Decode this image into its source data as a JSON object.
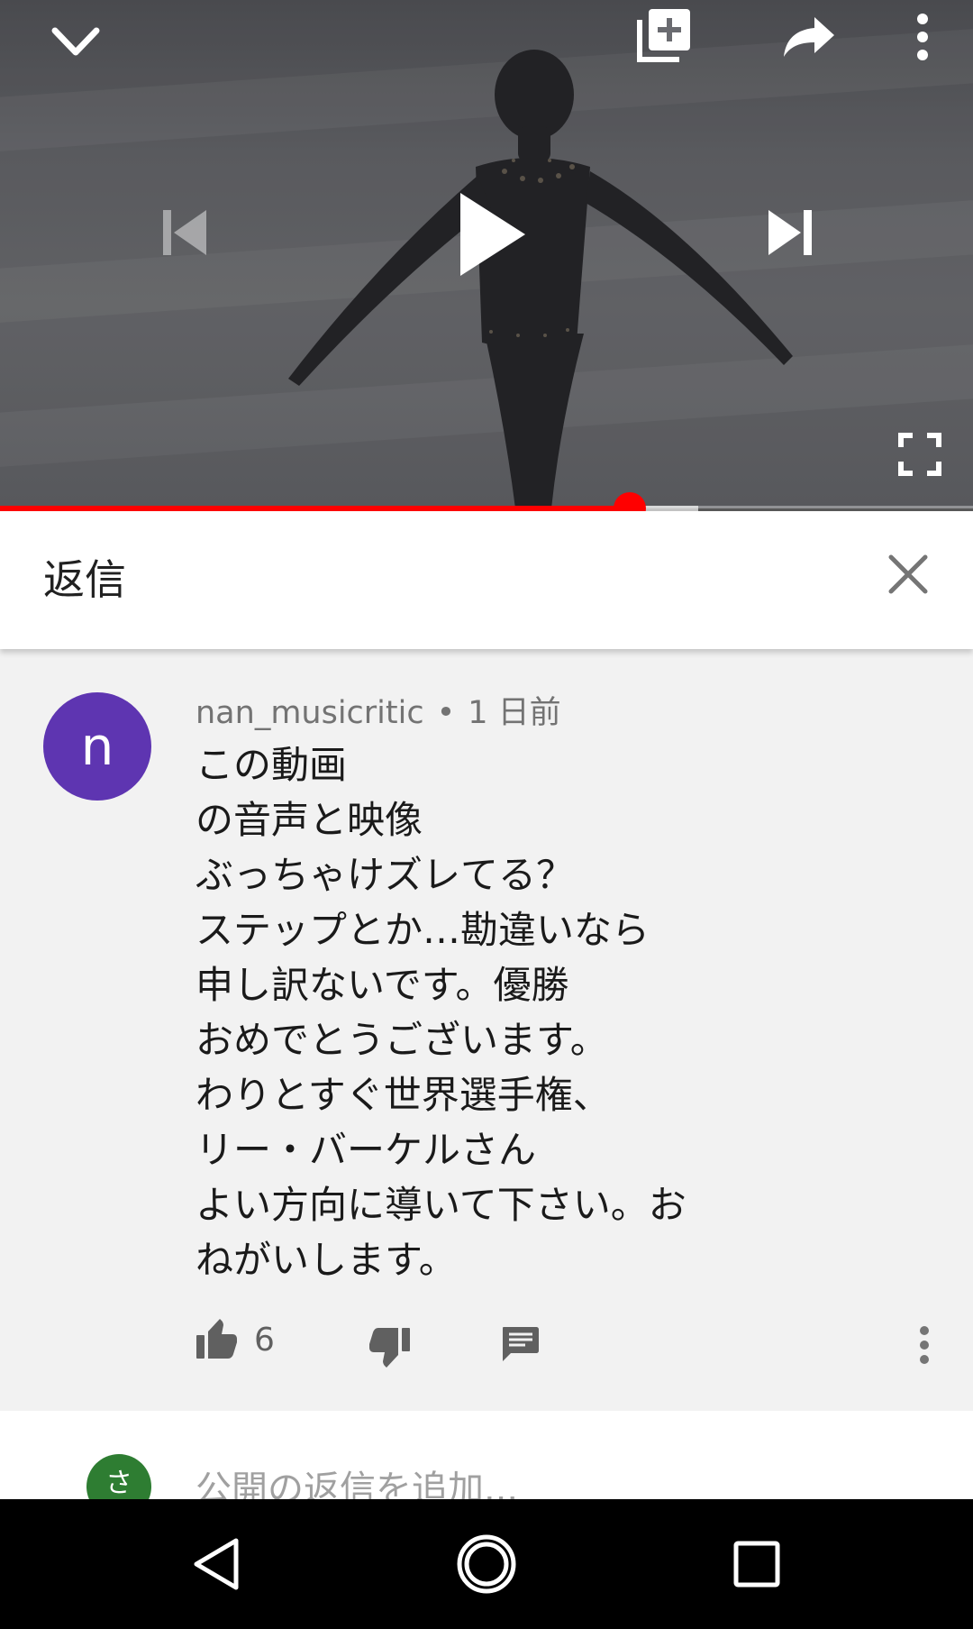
{
  "player": {
    "progress_percent": 64.7,
    "buffered_percent": 71.8,
    "icons": {
      "minimize": "chevron-down-icon",
      "add_to_playlist": "playlist-add-icon",
      "share": "share-icon",
      "more": "more-vert-icon",
      "previous": "skip-previous-icon",
      "play": "play-icon",
      "next": "skip-next-icon",
      "fullscreen": "fullscreen-icon"
    }
  },
  "replies_panel": {
    "title": "返信",
    "close_icon": "close-icon"
  },
  "comment": {
    "avatar_letter": "n",
    "avatar_color": "#5e35b1",
    "author": "nan_musicritic",
    "separator": "•",
    "time": "1 日前",
    "lines": [
      "この動画",
      "の音声と映像",
      "ぶっちゃけズレてる？",
      "ステップとか…勘違いなら",
      "申し訳ないです。優勝",
      "おめでとうございます。",
      "わりとすぐ世界選手権、",
      "リー・バーケルさん",
      "よい方向に導いて下さい。お",
      "ねがいします。"
    ],
    "like_count": "6"
  },
  "reply_input": {
    "avatar_letter": "さ",
    "avatar_color": "#2e7d32",
    "placeholder": "公開の返信を追加..."
  },
  "colors": {
    "accent": "#ff0000",
    "panel_bg": "#f2f2f2"
  }
}
